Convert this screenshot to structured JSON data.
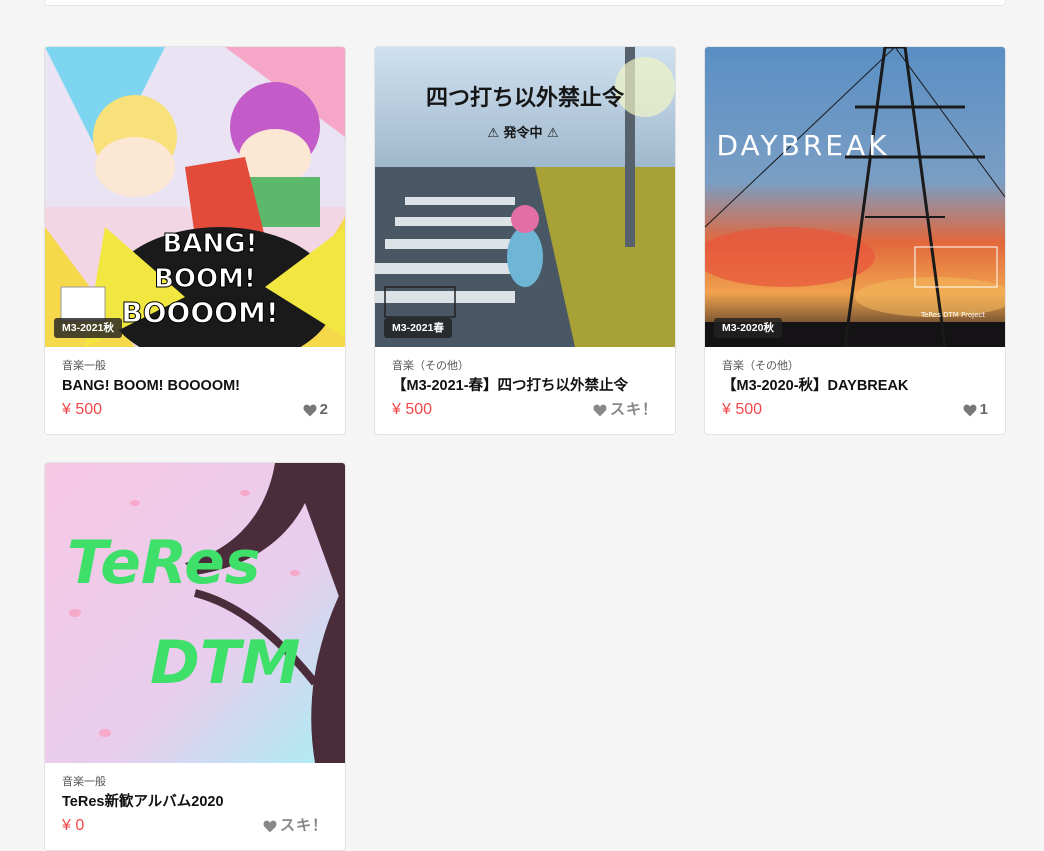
{
  "items": [
    {
      "badge": "M3-2021秋",
      "category": "音楽一般",
      "title": "BANG! BOOM! BOOOOM!",
      "price": "¥ 500",
      "likes": "2",
      "art_text": [
        "BANG!",
        "BOOM!",
        "BOOOOM!"
      ]
    },
    {
      "badge": "M3-2021春",
      "category": "音楽（その他）",
      "title": "【M3-2021-春】四つ打ち以外禁止令",
      "price": "¥ 500",
      "likes": "スキ！",
      "art_text": [
        "四つ打ち以外禁止令",
        "⚠ 発令中 ⚠"
      ]
    },
    {
      "badge": "M3-2020秋",
      "category": "音楽（その他）",
      "title": "【M3-2020-秋】DAYBREAK",
      "price": "¥ 500",
      "likes": "1",
      "art_text": [
        "DAYBREAK",
        "TeRes DTM Project"
      ]
    },
    {
      "badge": "",
      "category": "音楽一般",
      "title": "TeRes新歓アルバム2020",
      "price": "¥ 0",
      "likes": "スキ！",
      "art_text": [
        "TeRes",
        "DTM"
      ]
    }
  ],
  "colors": {
    "price": "#f0474a",
    "badge_bg": "#222222",
    "heart": "#777777"
  }
}
